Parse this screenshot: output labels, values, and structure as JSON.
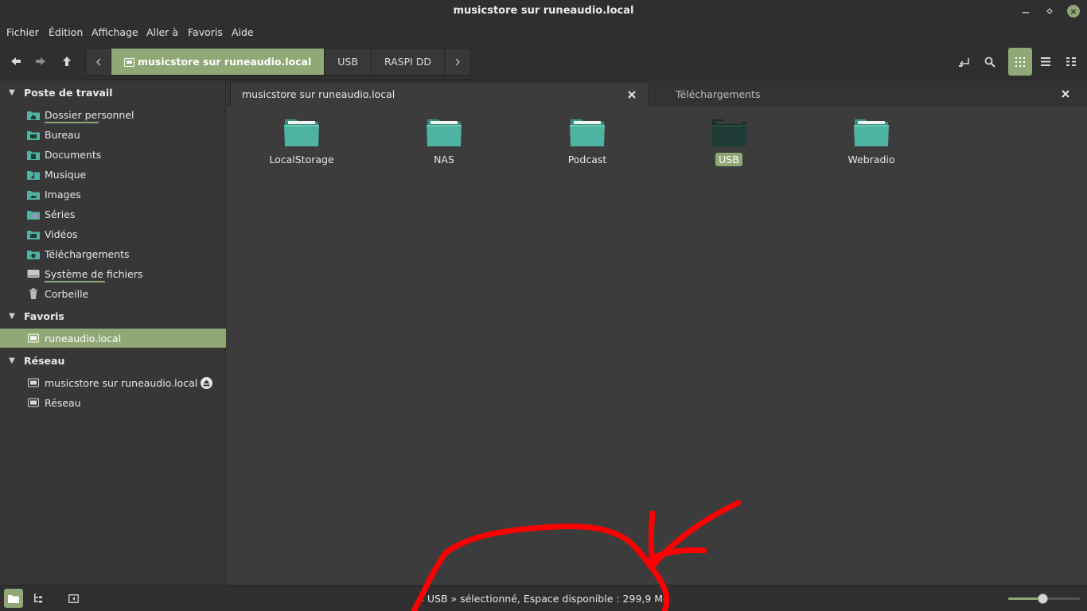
{
  "window": {
    "title": "musicstore sur runeaudio.local"
  },
  "menubar": [
    "Fichier",
    "Édition",
    "Affichage",
    "Aller à",
    "Favoris",
    "Aide"
  ],
  "toolbar": {
    "icons": [
      "back-arrow-icon",
      "forward-arrow-icon",
      "up-arrow-icon",
      "toggle-location-icon",
      "search-icon",
      "icon-view-icon",
      "list-view-icon",
      "compact-view-icon"
    ],
    "breadcrumbs": [
      {
        "label": "musicstore sur runeaudio.local",
        "active": true
      },
      {
        "label": "USB",
        "active": false
      },
      {
        "label": "RASPI DD",
        "active": false
      }
    ]
  },
  "sidebar": {
    "sections": [
      {
        "title": "Poste de travail",
        "items": [
          {
            "label": "Dossier personnel",
            "icon": "home-folder-icon",
            "usage": 0.6
          },
          {
            "label": "Bureau",
            "icon": "desktop-folder-icon"
          },
          {
            "label": "Documents",
            "icon": "documents-folder-icon"
          },
          {
            "label": "Musique",
            "icon": "music-folder-icon"
          },
          {
            "label": "Images",
            "icon": "pictures-folder-icon"
          },
          {
            "label": "Séries",
            "icon": "series-folder-icon"
          },
          {
            "label": "Vidéos",
            "icon": "videos-folder-icon"
          },
          {
            "label": "Téléchargements",
            "icon": "downloads-folder-icon"
          },
          {
            "label": "Système de fichiers",
            "icon": "filesystem-drive-icon",
            "usage": 0.62
          },
          {
            "label": "Corbeille",
            "icon": "trash-icon"
          }
        ]
      },
      {
        "title": "Favoris",
        "items": [
          {
            "label": "runeaudio.local",
            "icon": "network-share-icon",
            "selected": true
          }
        ]
      },
      {
        "title": "Réseau",
        "items": [
          {
            "label": "musicstore sur runeaudio.local",
            "icon": "network-share-icon",
            "eject": true
          },
          {
            "label": "Réseau",
            "icon": "network-icon"
          }
        ]
      }
    ]
  },
  "tabs": [
    {
      "label": "musicstore sur runeaudio.local",
      "active": true
    },
    {
      "label": "Téléchargements",
      "active": false
    }
  ],
  "folders": [
    {
      "name": "LocalStorage",
      "selected": false
    },
    {
      "name": "NAS",
      "selected": false
    },
    {
      "name": "Podcast",
      "selected": false
    },
    {
      "name": "USB",
      "selected": true
    },
    {
      "name": "Webradio",
      "selected": false
    }
  ],
  "statusbar": {
    "text": "« USB » sélectionné, Espace disponible : 299,9 Mo",
    "zoom_level": 0.48
  },
  "colors": {
    "accent": "#8fa876",
    "folder": "#4fb3a2",
    "folder_selected": "#1f3b36",
    "annotation": "#ff0000"
  }
}
